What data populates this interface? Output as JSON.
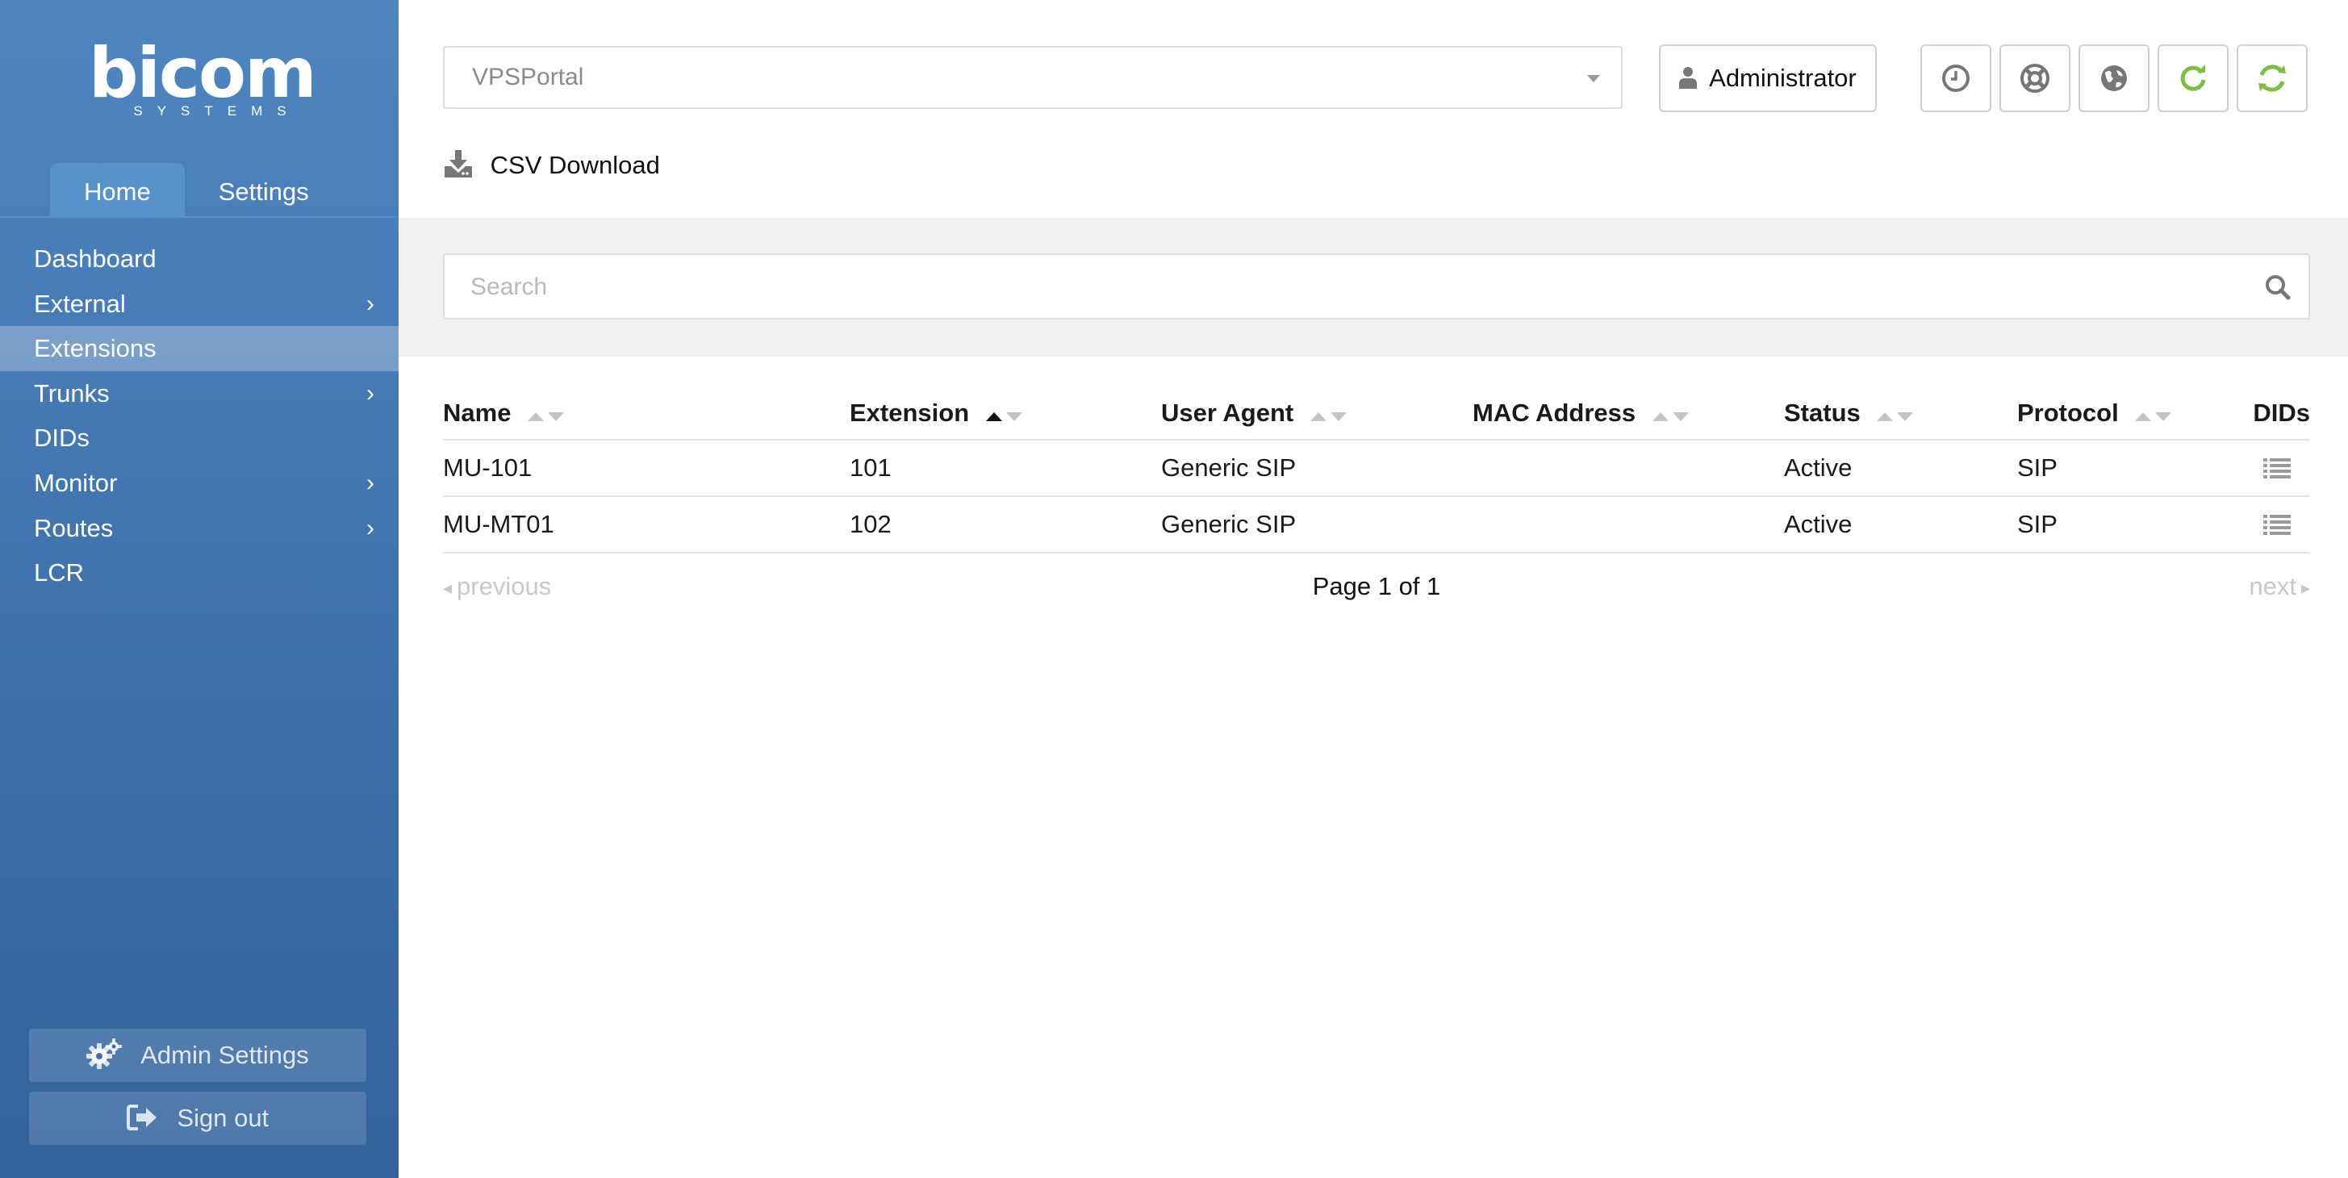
{
  "logo": {
    "word": "bicom",
    "sub": "SYSTEMS"
  },
  "sidebar": {
    "tabs": [
      {
        "label": "Home",
        "active": true
      },
      {
        "label": "Settings",
        "active": false
      }
    ],
    "items": [
      {
        "label": "Dashboard",
        "has_submenu": false
      },
      {
        "label": "External",
        "has_submenu": true
      },
      {
        "label": "Extensions",
        "has_submenu": false,
        "active": true
      },
      {
        "label": "Trunks",
        "has_submenu": true
      },
      {
        "label": "DIDs",
        "has_submenu": false
      },
      {
        "label": "Monitor",
        "has_submenu": true
      },
      {
        "label": "Routes",
        "has_submenu": true
      },
      {
        "label": "LCR",
        "has_submenu": false
      }
    ],
    "admin_settings_label": "Admin Settings",
    "sign_out_label": "Sign out"
  },
  "header": {
    "portal_selected": "VPSPortal",
    "user_label": "Administrator",
    "icons": [
      "clock-icon",
      "lifebuoy-icon",
      "globe-icon",
      "reload-icon",
      "sync-icon"
    ],
    "accent_green": "#7cc043"
  },
  "toolbar": {
    "csv_label": "CSV Download"
  },
  "search": {
    "placeholder": "Search"
  },
  "table": {
    "columns": [
      {
        "label": "Name",
        "sortable": true
      },
      {
        "label": "Extension",
        "sortable": true,
        "sorted": "asc"
      },
      {
        "label": "User Agent",
        "sortable": true
      },
      {
        "label": "MAC Address",
        "sortable": true
      },
      {
        "label": "Status",
        "sortable": true
      },
      {
        "label": "Protocol",
        "sortable": true
      },
      {
        "label": "DIDs",
        "sortable": false
      }
    ],
    "rows": [
      {
        "name": "MU-101",
        "extension": "101",
        "user_agent": "Generic SIP",
        "mac": "",
        "status": "Active",
        "protocol": "SIP"
      },
      {
        "name": "MU-MT01",
        "extension": "102",
        "user_agent": "Generic SIP",
        "mac": "",
        "status": "Active",
        "protocol": "SIP"
      }
    ]
  },
  "pagination": {
    "previous": "previous",
    "page_info": "Page 1 of 1",
    "next": "next"
  }
}
